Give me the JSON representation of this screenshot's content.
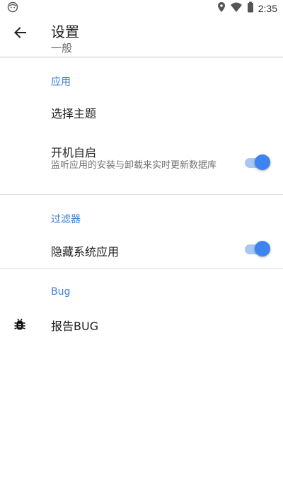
{
  "status_bar": {
    "time": "2:35",
    "icons": [
      "android-face-icon",
      "location-icon",
      "wifi-icon",
      "battery-icon"
    ]
  },
  "app_bar": {
    "title": "设置",
    "subtitle": "一般",
    "back_icon": "arrow-left-icon"
  },
  "sections": {
    "app": {
      "header": "应用",
      "choose_theme": {
        "title": "选择主题"
      },
      "autostart": {
        "title": "开机自启",
        "summary": "监听应用的安装与卸载来实时更新数据库",
        "enabled": true
      }
    },
    "filter": {
      "header": "过滤器",
      "hide_system": {
        "title": "隐藏系统应用",
        "enabled": true
      }
    },
    "bug": {
      "header": "Bug",
      "report": {
        "title": "报告BUG",
        "icon": "bug-icon"
      }
    }
  },
  "colors": {
    "accent": "#3c7fd6",
    "switch_thumb": "#3d84f0",
    "switch_track": "#a9c7f3",
    "divider": "#dcdcdc"
  }
}
